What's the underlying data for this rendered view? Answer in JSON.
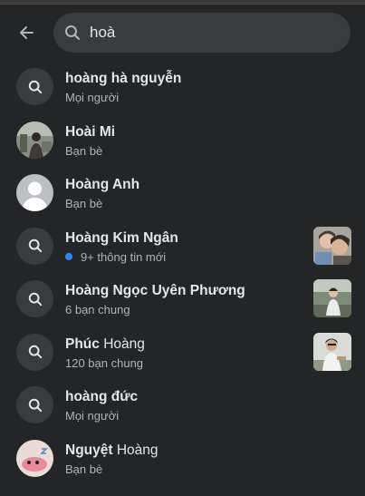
{
  "search": {
    "value": "hoà"
  },
  "results": [
    {
      "name_bold": "hoàng hà nguyễn",
      "name_plain": "",
      "subtitle": "Mọi người"
    },
    {
      "name_bold": "Hoài Mi",
      "name_plain": "",
      "subtitle": "Bạn bè"
    },
    {
      "name_bold": "Hoàng Anh",
      "name_plain": "",
      "subtitle": "Bạn bè"
    },
    {
      "name_bold": "Hoàng Kim Ngân",
      "name_plain": "",
      "subtitle": "9+ thông tin mới"
    },
    {
      "name_bold": "Hoàng Ngọc Uyên Phương",
      "name_plain": "",
      "subtitle": "6 bạn chung"
    },
    {
      "name_bold": "Phúc",
      "name_plain": " Hoàng",
      "subtitle": "120 bạn chung"
    },
    {
      "name_bold": "hoàng đức",
      "name_plain": "",
      "subtitle": "Mọi người"
    },
    {
      "name_bold": "Nguyệt",
      "name_plain": " Hoàng",
      "subtitle": "Bạn bè"
    }
  ],
  "colors": {
    "background": "#242526",
    "search_field": "#3a3b3c",
    "unread_dot": "#2d88ff"
  },
  "icons": {
    "back": "arrow-left-icon",
    "search": "search-icon"
  }
}
